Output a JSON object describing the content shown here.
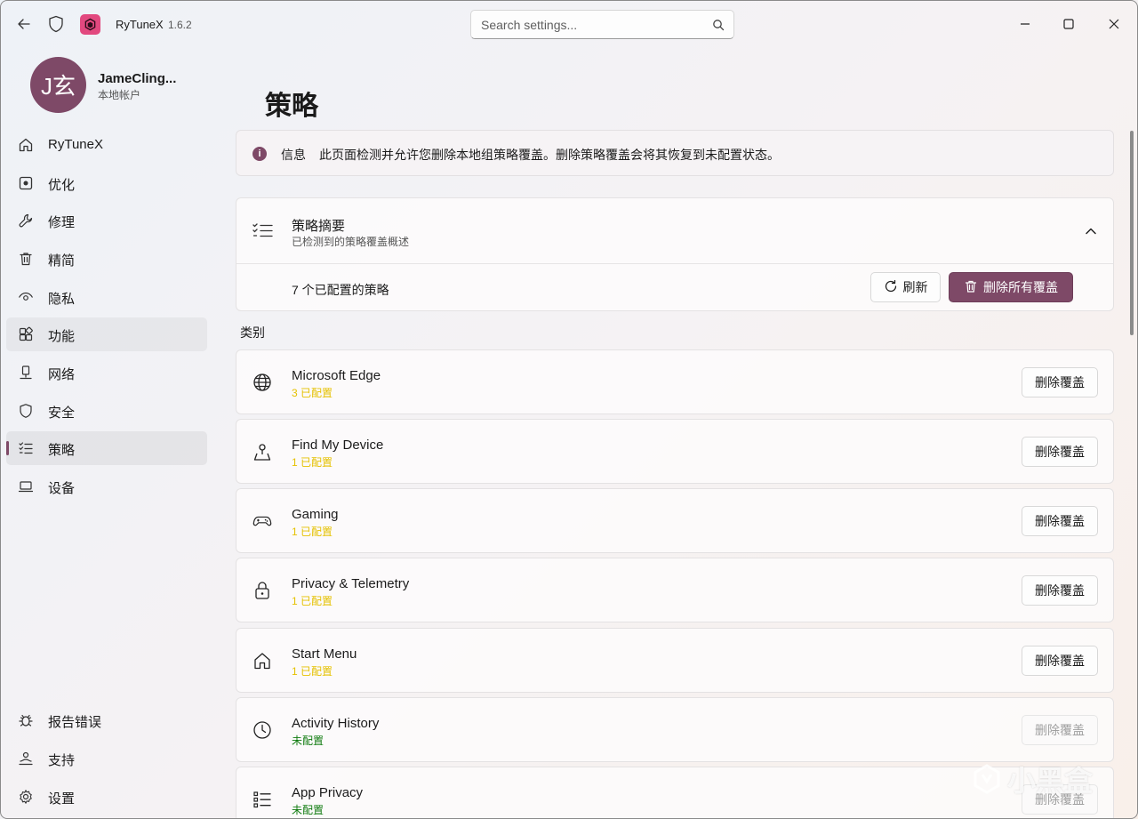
{
  "titlebar": {
    "app_name": "RyTuneX",
    "version": "1.6.2",
    "search_placeholder": "Search settings..."
  },
  "user": {
    "avatar_text": "J玄",
    "name": "JameCling...",
    "account_type": "本地帐户"
  },
  "nav": {
    "items": [
      {
        "label": "RyTuneX",
        "icon": "home-icon"
      },
      {
        "label": "优化",
        "icon": "optimize-icon"
      },
      {
        "label": "修理",
        "icon": "wrench-icon"
      },
      {
        "label": "精简",
        "icon": "trash-icon"
      },
      {
        "label": "隐私",
        "icon": "eye-icon"
      },
      {
        "label": "功能",
        "icon": "features-icon"
      },
      {
        "label": "网络",
        "icon": "network-icon"
      },
      {
        "label": "安全",
        "icon": "shield-icon"
      },
      {
        "label": "策略",
        "icon": "policy-icon"
      },
      {
        "label": "设备",
        "icon": "laptop-icon"
      }
    ],
    "footer": [
      {
        "label": "报告错误",
        "icon": "bug-icon"
      },
      {
        "label": "支持",
        "icon": "support-icon"
      },
      {
        "label": "设置",
        "icon": "gear-icon"
      }
    ]
  },
  "page": {
    "title": "策略",
    "info_title": "信息",
    "info_message": "此页面检测并允许您删除本地组策略覆盖。删除策略覆盖会将其恢复到未配置状态。",
    "summary_title": "策略摘要",
    "summary_subtitle": "已检测到的策略覆盖概述",
    "summary_count": "7 个已配置的策略",
    "refresh_label": "刷新",
    "delete_all_label": "删除所有覆盖",
    "categories_label": "类别",
    "delete_override_label": "删除覆盖"
  },
  "categories": [
    {
      "name": "Microsoft Edge",
      "status": "3 已配置",
      "icon": "globe-icon",
      "configured": true
    },
    {
      "name": "Find My Device",
      "status": "1 已配置",
      "icon": "location-icon",
      "configured": true
    },
    {
      "name": "Gaming",
      "status": "1 已配置",
      "icon": "gamepad-icon",
      "configured": true
    },
    {
      "name": "Privacy & Telemetry",
      "status": "1 已配置",
      "icon": "lock-icon",
      "configured": true
    },
    {
      "name": "Start Menu",
      "status": "1 已配置",
      "icon": "home-icon",
      "configured": true
    },
    {
      "name": "Activity History",
      "status": "未配置",
      "icon": "clock-icon",
      "configured": false
    },
    {
      "name": "App Privacy",
      "status": "未配置",
      "icon": "list-icon",
      "configured": false
    }
  ],
  "colors": {
    "accent": "#7e4967",
    "configured": "#e5c100",
    "not_configured": "#0f7b0f"
  },
  "watermark": "小黑盒"
}
